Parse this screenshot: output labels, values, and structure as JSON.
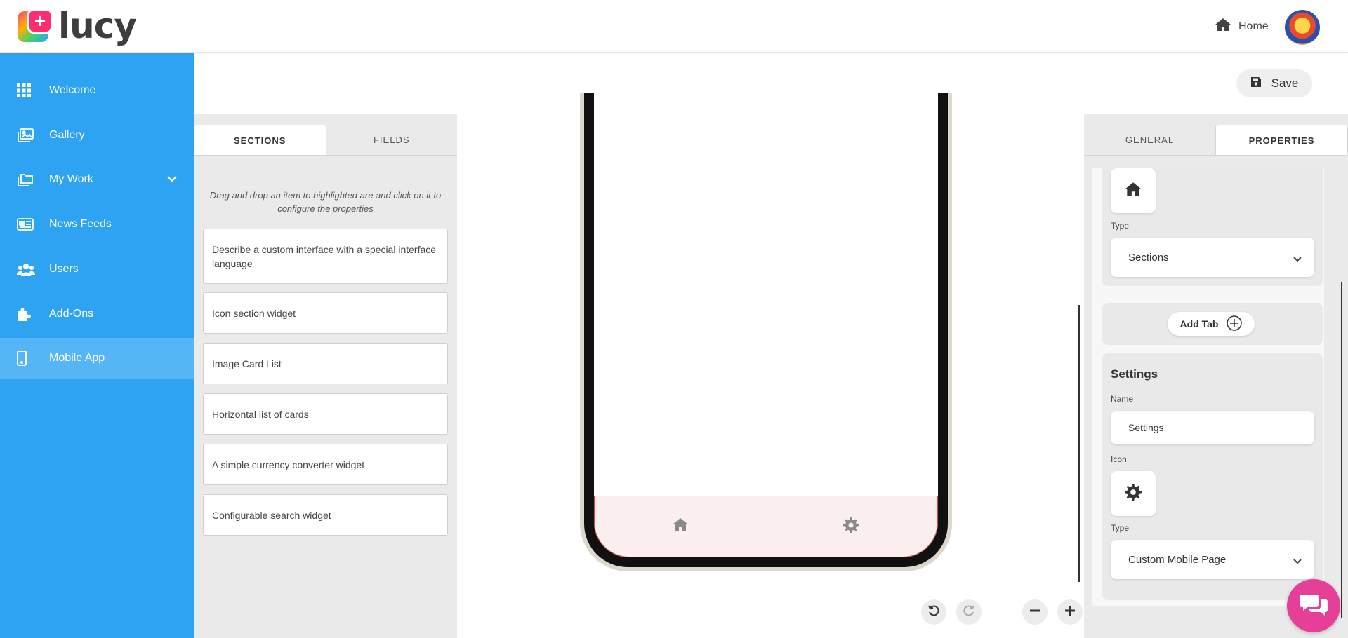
{
  "brand": {
    "name": "lucy"
  },
  "header": {
    "home_label": "Home"
  },
  "sidebar": {
    "items": [
      {
        "label": "Welcome",
        "icon": "grid-icon"
      },
      {
        "label": "Gallery",
        "icon": "images-icon"
      },
      {
        "label": "My Work",
        "icon": "folders-icon"
      },
      {
        "label": "News Feeds",
        "icon": "newspaper-icon"
      },
      {
        "label": "Users",
        "icon": "users-icon"
      },
      {
        "label": "Add-Ons",
        "icon": "puzzle-icon"
      },
      {
        "label": "Mobile App",
        "icon": "mobile-icon"
      }
    ],
    "active": "Mobile App"
  },
  "toolbar": {
    "save_label": "Save"
  },
  "left_panel": {
    "tabs": [
      "SECTIONS",
      "FIELDS"
    ],
    "active_tab": "SECTIONS",
    "hint": "Drag and drop an item to highlighted are and click on it to configure the properties",
    "widgets": [
      "Describe a custom interface with a special interface language",
      "Icon section widget",
      "Image Card List",
      "Horizontal list of cards",
      "A simple currency converter widget",
      "Configurable search widget"
    ]
  },
  "right_panel": {
    "tabs": [
      "GENERAL",
      "PROPERTIES"
    ],
    "active_tab": "PROPERTIES",
    "tab1": {
      "type_label": "Type",
      "type_value": "Sections",
      "icon": "home-icon"
    },
    "add_tab_label": "Add Tab",
    "tab2": {
      "title": "Settings",
      "name_label": "Name",
      "name_value": "Settings",
      "icon_label": "Icon",
      "icon": "gear-icon",
      "type_label": "Type",
      "type_value": "Custom Mobile Page"
    }
  },
  "colors": {
    "sidebar": "#2ea3f2",
    "sidebar_active": "#56b6f5",
    "chat": "#e53f97",
    "tabbar_outline": "#e04a4a"
  }
}
